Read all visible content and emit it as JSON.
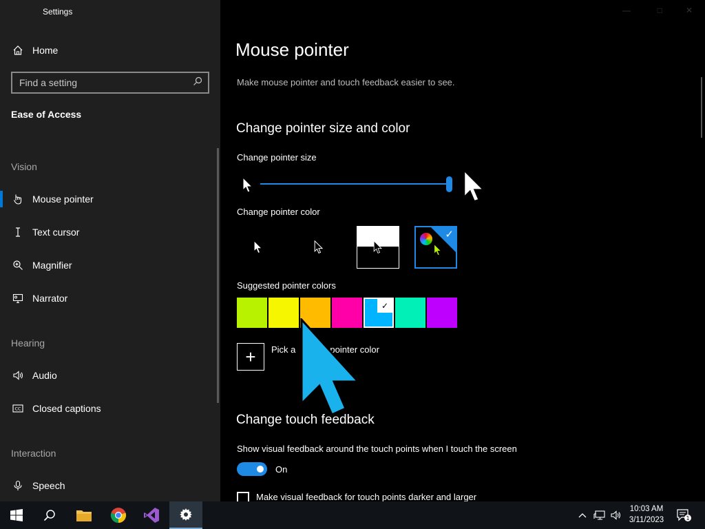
{
  "window": {
    "title": "Settings"
  },
  "sidebar": {
    "home_label": "Home",
    "search_placeholder": "Find a setting",
    "section_title": "Ease of Access",
    "groups": {
      "vision": "Vision",
      "hearing": "Hearing",
      "interaction": "Interaction"
    },
    "items": {
      "mouse_pointer": "Mouse pointer",
      "text_cursor": "Text cursor",
      "magnifier": "Magnifier",
      "narrator": "Narrator",
      "audio": "Audio",
      "closed_captions": "Closed captions",
      "speech": "Speech"
    },
    "selected_item": "Mouse pointer"
  },
  "main": {
    "title": "Mouse pointer",
    "description": "Make mouse pointer and touch feedback easier to see.",
    "section_pointer": "Change pointer size and color",
    "size_label": "Change pointer size",
    "size_slider_value": 1.0,
    "color_label": "Change pointer color",
    "color_options": [
      "white",
      "black",
      "inverted",
      "custom"
    ],
    "selected_color_option": "custom",
    "suggested_label": "Suggested pointer colors",
    "suggested_colors": [
      "#b8f200",
      "#f6f600",
      "#ffbb00",
      "#ff00a8",
      "#00b4ff",
      "#00f0b8",
      "#be00ff"
    ],
    "selected_suggested_index": 4,
    "pick_label_start": "Pick a",
    "pick_label_end": "pointer color",
    "section_touch": "Change touch feedback",
    "touch_label": "Show visual feedback around the touch points when I touch the screen",
    "touch_toggle_state": "On",
    "darker_label": "Make visual feedback for touch points darker and larger",
    "darker_checked": false
  },
  "taskbar": {
    "apps": [
      "start",
      "search",
      "file-explorer",
      "chrome",
      "visual-studio",
      "settings"
    ],
    "active_app": "settings",
    "time": "10:03 AM",
    "date": "3/11/2023",
    "notification_count": "1"
  },
  "colors": {
    "accent": "#1e8ae6",
    "sidebar_bg": "#1f1f1f",
    "main_bg": "#000000",
    "big_cursor": "#1ab2ec"
  }
}
